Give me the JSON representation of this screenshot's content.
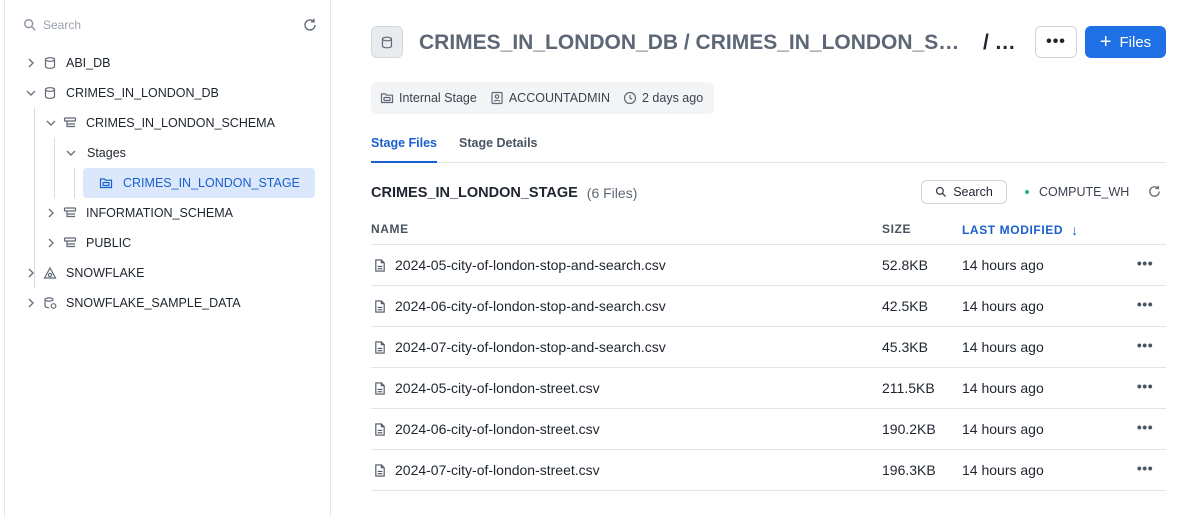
{
  "sidebar": {
    "search_placeholder": "Search",
    "tree": [
      {
        "label": "ABI_DB",
        "icon": "database-icon"
      },
      {
        "label": "CRIMES_IN_LONDON_DB",
        "icon": "database-icon"
      },
      {
        "label": "CRIMES_IN_LONDON_SCHEMA",
        "icon": "schema-icon"
      },
      {
        "label": "Stages",
        "icon": ""
      },
      {
        "label": "CRIMES_IN_LONDON_STAGE",
        "icon": "stage-icon",
        "selected": true
      },
      {
        "label": "INFORMATION_SCHEMA",
        "icon": "schema-icon"
      },
      {
        "label": "PUBLIC",
        "icon": "schema-icon"
      },
      {
        "label": "SNOWFLAKE",
        "icon": "snowflake-share-icon"
      },
      {
        "label": "SNOWFLAKE_SAMPLE_DATA",
        "icon": "shared-database-icon"
      }
    ]
  },
  "header": {
    "path": "CRIMES_IN_LONDON_DB / CRIMES_IN_LONDON_SCHEMA",
    "tail": "/ CRIMES_IN_LONDON_STAGE",
    "more_label": "•••",
    "files_button": "Files",
    "files_plus": "+"
  },
  "meta": {
    "stage_type": "Internal Stage",
    "owner": "ACCOUNTADMIN",
    "created": "2 days ago"
  },
  "tabs": [
    "Stage Files",
    "Stage Details"
  ],
  "stage": {
    "name": "CRIMES_IN_LONDON_STAGE",
    "count": "(6 Files)",
    "search_label": "Search",
    "warehouse": "COMPUTE_WH"
  },
  "table": {
    "columns": [
      "NAME",
      "SIZE",
      "LAST MODIFIED"
    ],
    "sort_indicator": "↓",
    "row_more": "•••",
    "rows": [
      {
        "name": "2024-05-city-of-london-stop-and-search.csv",
        "size": "52.8KB",
        "modified": "14 hours ago"
      },
      {
        "name": "2024-06-city-of-london-stop-and-search.csv",
        "size": "42.5KB",
        "modified": "14 hours ago"
      },
      {
        "name": "2024-07-city-of-london-stop-and-search.csv",
        "size": "45.3KB",
        "modified": "14 hours ago"
      },
      {
        "name": "2024-05-city-of-london-street.csv",
        "size": "211.5KB",
        "modified": "14 hours ago"
      },
      {
        "name": "2024-06-city-of-london-street.csv",
        "size": "190.2KB",
        "modified": "14 hours ago"
      },
      {
        "name": "2024-07-city-of-london-street.csv",
        "size": "196.3KB",
        "modified": "14 hours ago"
      }
    ]
  },
  "colors": {
    "accent": "#1f6fe5",
    "selected_bg": "#dbe8fb",
    "warehouse_dot": "#2db37a"
  }
}
